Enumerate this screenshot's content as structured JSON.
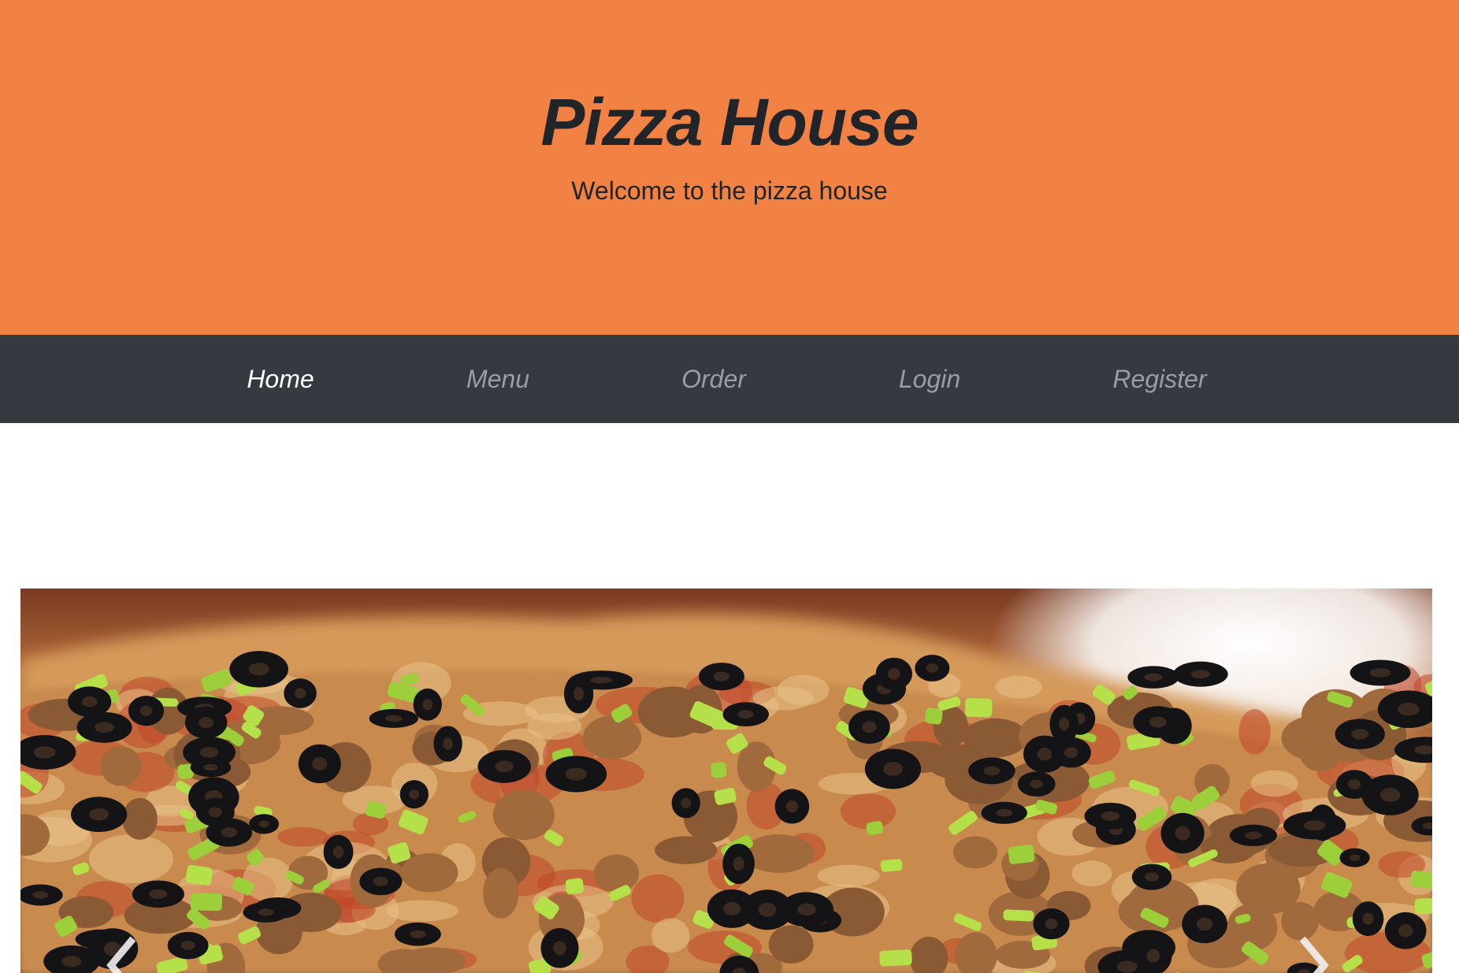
{
  "header": {
    "title": "Pizza House",
    "tagline": "Welcome to the pizza house"
  },
  "nav": {
    "items": [
      {
        "label": "Home",
        "active": true
      },
      {
        "label": "Menu",
        "active": false
      },
      {
        "label": "Order",
        "active": false
      },
      {
        "label": "Login",
        "active": false
      },
      {
        "label": "Register",
        "active": false
      }
    ]
  },
  "carousel": {
    "image": "pizza-photo",
    "prev_icon": "chevron-left-icon",
    "next_icon": "chevron-right-icon"
  },
  "colors": {
    "hero_bg": "#f28244",
    "navbar_bg": "#343a40",
    "nav_active": "#ffffff",
    "nav_inactive": "#9a9da1"
  }
}
